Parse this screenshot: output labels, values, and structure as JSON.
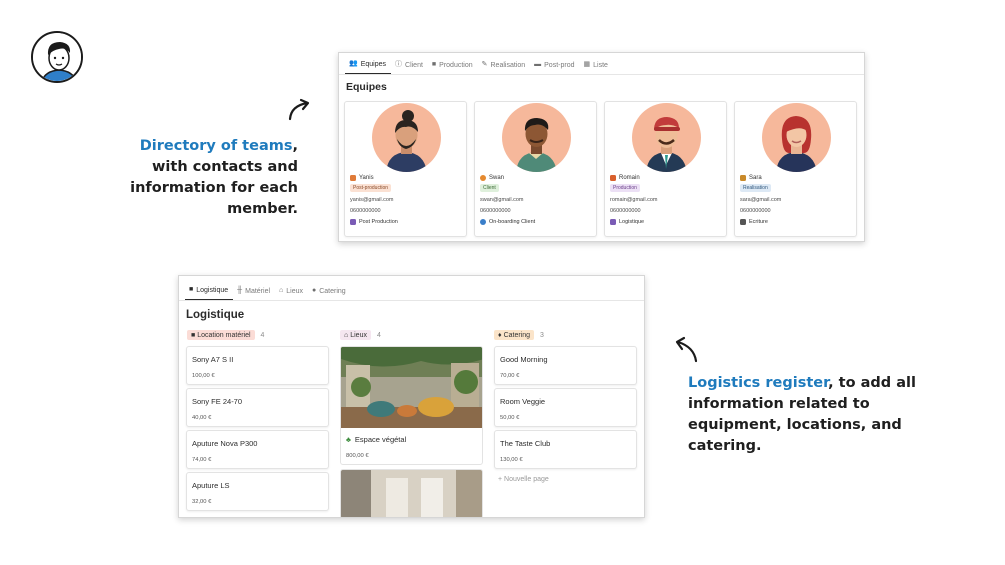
{
  "callouts": {
    "left": {
      "highlight": "Directory of teams",
      "rest": ", with contacts and information for each member."
    },
    "right": {
      "highlight": "Logistics register",
      "rest": ", to add all information related to equipment, locations, and catering."
    }
  },
  "teams_window": {
    "tabs": [
      {
        "label": "Equipes",
        "icon": "people-icon"
      },
      {
        "label": "Client",
        "icon": "info-icon"
      },
      {
        "label": "Production",
        "icon": "video-icon"
      },
      {
        "label": "Realisation",
        "icon": "pencil-icon"
      },
      {
        "label": "Post-prod",
        "icon": "monitor-icon"
      },
      {
        "label": "Liste",
        "icon": "table-icon"
      }
    ],
    "title": "Equipes",
    "members": [
      {
        "name": "Yanis",
        "role": "Post-production",
        "email": "yanis@gmail.com",
        "phone": "0600000000",
        "team": "Post Production",
        "role_bg": "#fbe1d3",
        "role_fg": "#8a4b2a",
        "icon_color": "#e07b39",
        "team_icon_color": "#7a5bb5"
      },
      {
        "name": "Swan",
        "role": "Client",
        "email": "swan@gmail.com",
        "phone": "0600000000",
        "team": "On-boarding Client",
        "role_bg": "#dff0dc",
        "role_fg": "#3d6b36",
        "icon_color": "#e58a2f",
        "team_icon_color": "#3a7ec9"
      },
      {
        "name": "Romain",
        "role": "Production",
        "email": "romain@gmail.com",
        "phone": "0600000000",
        "team": "Logistique",
        "role_bg": "#ece0f5",
        "role_fg": "#6b3f8a",
        "icon_color": "#d9602c",
        "team_icon_color": "#7a5bb5"
      },
      {
        "name": "Sara",
        "role": "Realisation",
        "email": "sara@gmail.com",
        "phone": "0600000000",
        "team": "Ecriture",
        "role_bg": "#dde9f5",
        "role_fg": "#32597e",
        "icon_color": "#c98a2a",
        "team_icon_color": "#555555"
      }
    ]
  },
  "logistics_window": {
    "tabs": [
      {
        "label": "Logistique",
        "icon": "video-icon"
      },
      {
        "label": "Matériel",
        "icon": "equipment-icon"
      },
      {
        "label": "Lieux",
        "icon": "home-icon"
      },
      {
        "label": "Catering",
        "icon": "plate-icon"
      }
    ],
    "title": "Logistique",
    "columns": [
      {
        "label": "Location matériel",
        "count": "4",
        "bg": "#fbdcd6",
        "items": [
          {
            "name": "Sony A7 S II",
            "price": "100,00 €"
          },
          {
            "name": "Sony FE 24-70",
            "price": "40,00 €"
          },
          {
            "name": "Aputure Nova P300",
            "price": "74,00 €"
          },
          {
            "name": "Aputure LS",
            "price": "32,00 €"
          }
        ]
      },
      {
        "label": "Lieux",
        "count": "4",
        "bg": "#f5e6f0",
        "items": [
          {
            "name": "Espace végétal",
            "price": "800,00 €"
          }
        ]
      },
      {
        "label": "Catering",
        "count": "3",
        "bg": "#fbe4c9",
        "items": [
          {
            "name": "Good Morning",
            "price": "70,00 €"
          },
          {
            "name": "Room Veggie",
            "price": "50,00 €"
          },
          {
            "name": "The Taste Club",
            "price": "130,00 €"
          }
        ]
      }
    ],
    "new_page": "+ Nouvelle page"
  }
}
